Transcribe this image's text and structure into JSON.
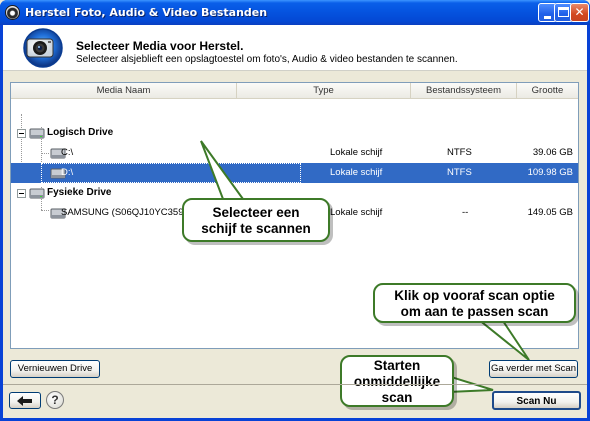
{
  "window": {
    "title": "Herstel Foto, Audio & Video Bestanden",
    "min_glyph": "",
    "max_glyph": "",
    "close_glyph": "✕"
  },
  "header": {
    "title": "Selecteer Media voor Herstel.",
    "subtitle": "Selecteer alsjeblieft een opslagtoestel om foto's, Audio & video bestanden te scannen."
  },
  "listview": {
    "columns": [
      "Media Naam",
      "Type",
      "Bestandssysteem",
      "Grootte"
    ],
    "groups": [
      {
        "label": "Logisch Drive",
        "items": [
          {
            "name": "C:\\",
            "type": "Lokale schijf",
            "fs": "NTFS",
            "size": "39.06 GB",
            "selected": false
          },
          {
            "name": "D:\\",
            "type": "Lokale schijf",
            "fs": "NTFS",
            "size": "109.98 GB",
            "selected": true
          }
        ]
      },
      {
        "label": "Fysieke Drive",
        "items": [
          {
            "name": "SAMSUNG (S06QJ10YC35964)",
            "type": "Lokale schijf",
            "fs": "--",
            "size": "149.05 GB",
            "selected": false
          }
        ]
      }
    ]
  },
  "callouts": {
    "select_drive": "Selecteer een\nschijf te scannen",
    "prescan": "Klik op vooraf scan optie\nom aan te passen scan",
    "start": "Starten\nonmiddellijke\nscan"
  },
  "buttons": {
    "refresh": "Vernieuwen Drive",
    "continue_scan": "Ga verder met Scan",
    "scan_now": "Scan Nu",
    "help": "?"
  },
  "colors": {
    "titlebar": "#0554e0",
    "selection": "#316ac5",
    "callout_border": "#3d7a28",
    "face": "#ece9d8"
  },
  "icons": [
    "app-icon",
    "logo-icon",
    "drive-icon",
    "expander-icon",
    "back-arrow-icon",
    "help-icon"
  ]
}
